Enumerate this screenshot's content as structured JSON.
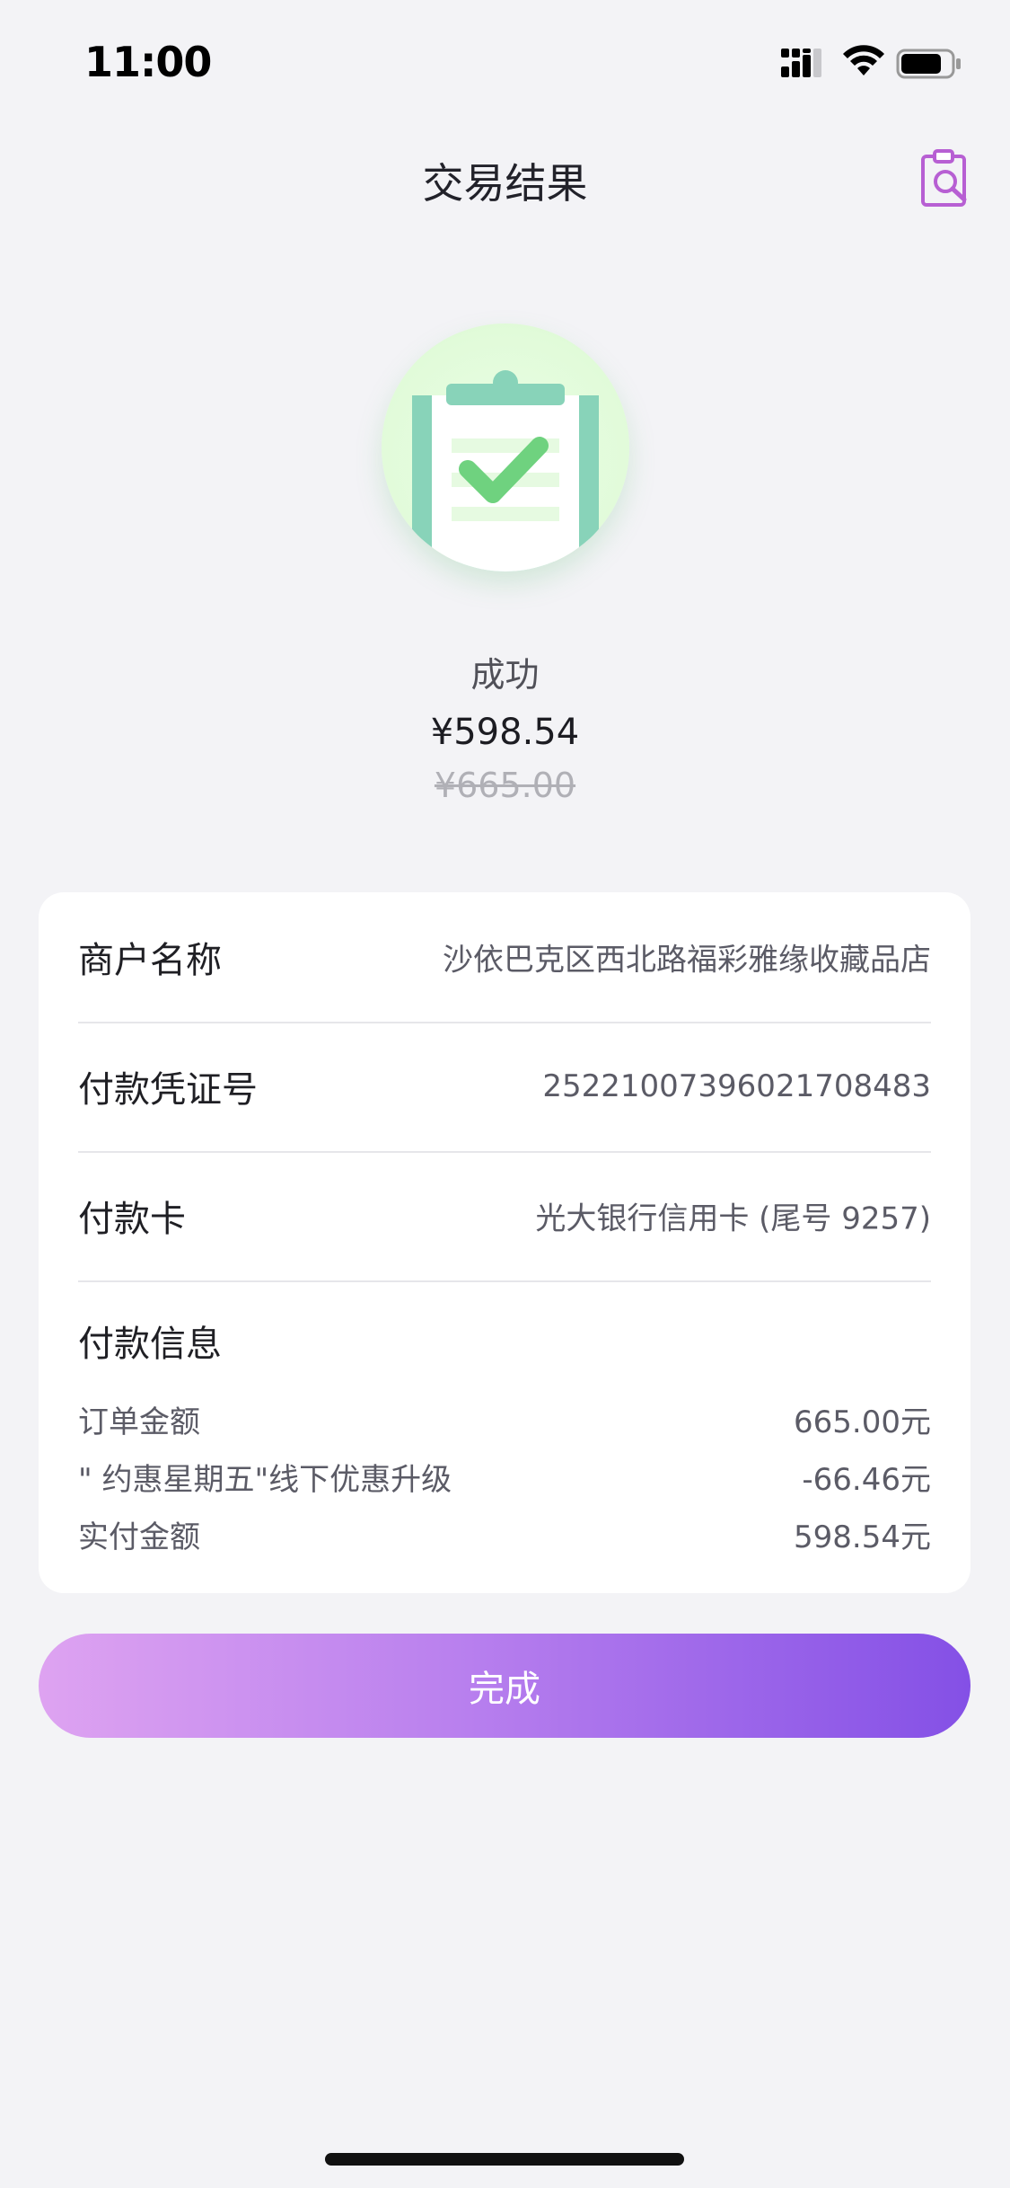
{
  "status_bar": {
    "time": "11:00"
  },
  "header": {
    "title": "交易结果",
    "action_icon": "receipt-search-icon"
  },
  "result": {
    "status": "成功",
    "paid_amount": "¥598.54",
    "original_amount": "¥665.00",
    "icon": "clipboard-check-icon",
    "colors": {
      "circle_bg": "#e1fbd9",
      "clipboard": "#88d3b9",
      "check": "#6fd27f"
    }
  },
  "details": {
    "merchant": {
      "label": "商户名称",
      "value": "沙依巴克区西北路福彩雅缘收藏品店"
    },
    "voucher": {
      "label": "付款凭证号",
      "value": "25221007396021708483"
    },
    "card": {
      "label": "付款卡",
      "value": "光大银行信用卡 (尾号 9257)"
    },
    "payment_info": {
      "title": "付款信息",
      "lines": [
        {
          "label": "订单金额",
          "value": "665.00元"
        },
        {
          "label": "\" 约惠星期五\"线下优惠升级",
          "value": "-66.46元"
        },
        {
          "label": "实付金额",
          "value": "598.54元"
        }
      ]
    }
  },
  "actions": {
    "done_label": "完成",
    "gradient": [
      "#dea3f1",
      "#b980ee",
      "#8450e6"
    ]
  }
}
